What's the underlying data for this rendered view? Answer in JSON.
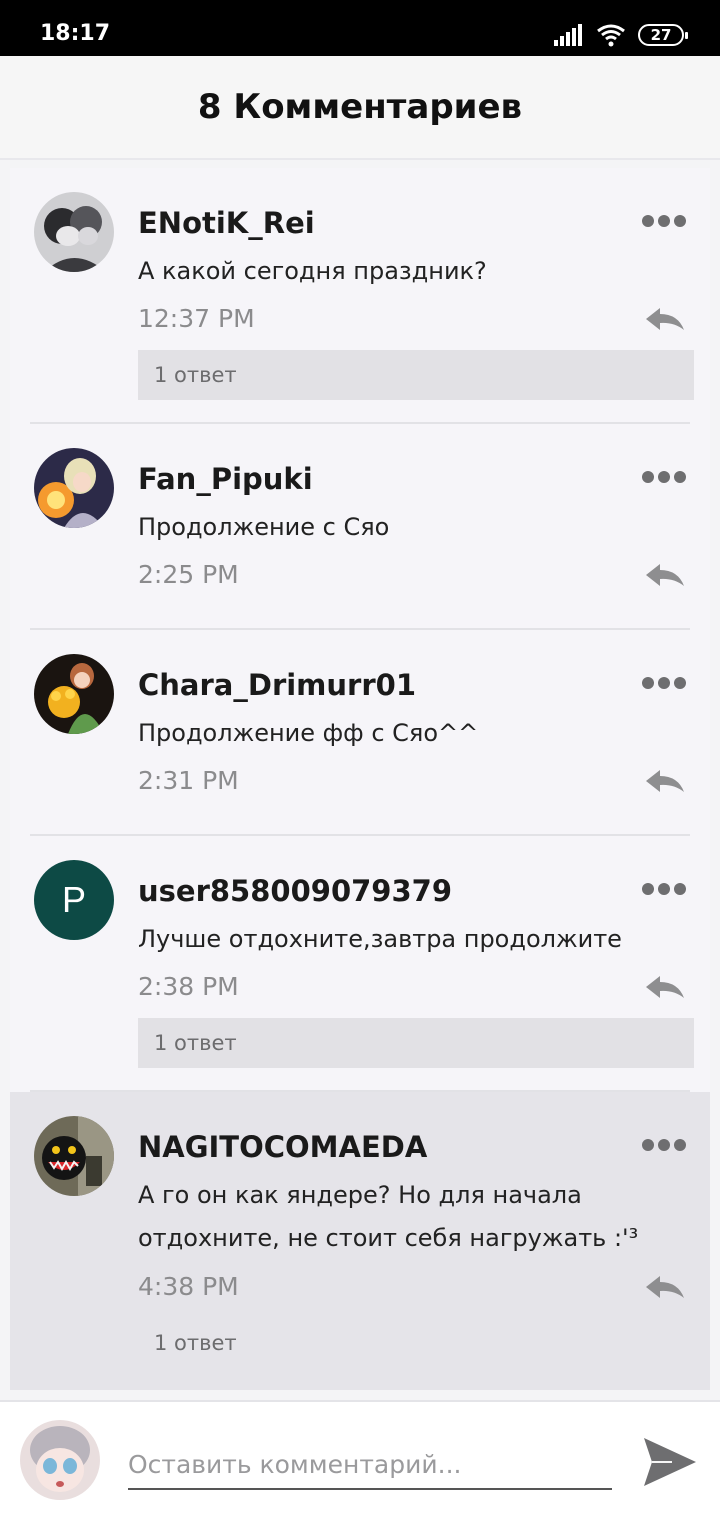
{
  "status_bar": {
    "time": "18:17",
    "battery": "27"
  },
  "header": {
    "title": "8 Комментариев"
  },
  "comments": [
    {
      "username": "ENotiK_Rei",
      "text": "А какой сегодня праздник?",
      "time": "12:37 PM",
      "replies_label": "1 ответ",
      "avatar": "anime-girls-avatar"
    },
    {
      "username": "Fan_Pipuki",
      "text": "Продолжение с Сяо",
      "time": "2:25 PM",
      "replies_label": "",
      "avatar": "glowing-character-avatar"
    },
    {
      "username": "Chara_Drimurr01",
      "text": "Продолжение фф с Сяо^^",
      "time": "2:31 PM",
      "replies_label": "",
      "avatar": "chara-flowers-avatar"
    },
    {
      "username": "user858009079379",
      "text": "Лучше отдохните,завтра продолжите",
      "time": "2:38 PM",
      "replies_label": "1 ответ",
      "avatar_letter": "P",
      "avatar_color": "#0d4a45"
    },
    {
      "username": "NAGITOCOMAEDA",
      "text": "А го он как яндере? Но для начала отдохните, не стоит себя нагружать :'³",
      "time": "4:38 PM",
      "replies_label": "1 ответ",
      "avatar": "monster-smile-avatar"
    }
  ],
  "composer": {
    "placeholder": "Оставить комментарий..."
  },
  "colors": {
    "accent_avatar": "#0d4a45",
    "highlight_row": "#e5e4e9"
  }
}
